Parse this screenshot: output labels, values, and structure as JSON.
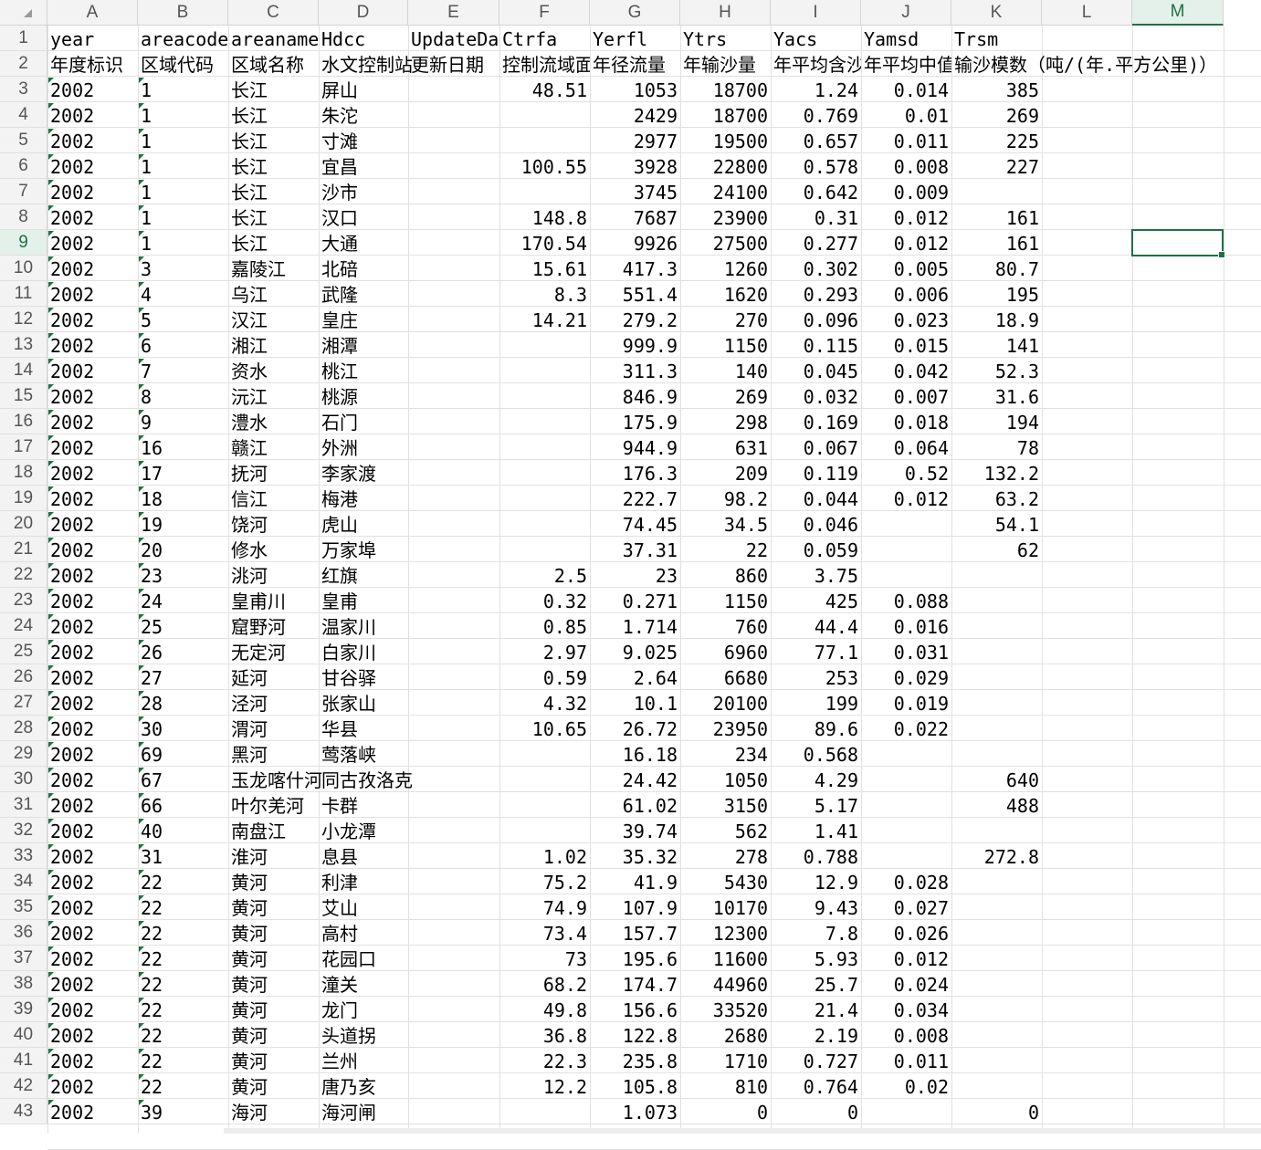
{
  "sheet": {
    "columns": [
      "A",
      "B",
      "C",
      "D",
      "E",
      "F",
      "G",
      "H",
      "I",
      "J",
      "K",
      "L",
      "M"
    ],
    "active_column": "M",
    "active_row": 9,
    "selected_cell": "M9",
    "rows": [
      {
        "n": "1",
        "A": "year",
        "B": "areacode",
        "C": "areaname",
        "D": "Hdcc",
        "E": "UpdateDate",
        "F": "Ctrfa",
        "G": "Yerfl",
        "H": "Ytrs",
        "I": "Yacs",
        "J": "Yamsd",
        "K": "Trsm",
        "L": "",
        "M": ""
      },
      {
        "n": "2",
        "A": "年度标识",
        "B": "区域代码",
        "C": "区域名称",
        "D": "水文控制站",
        "E": "更新日期",
        "F": "控制流域面积",
        "G": "年径流量",
        "H": "年输沙量",
        "I": "年平均含沙量",
        "J": "年平均中值粒径",
        "K": "输沙模数（吨/(年.平方公里)）",
        "L": "",
        "M": ""
      },
      {
        "n": "3",
        "A": "2002",
        "B": "1",
        "C": "长江",
        "D": "屏山",
        "E": "",
        "F": "48.51",
        "G": "1053",
        "H": "18700",
        "I": "1.24",
        "J": "0.014",
        "K": "385",
        "L": "",
        "M": ""
      },
      {
        "n": "4",
        "A": "2002",
        "B": "1",
        "C": "长江",
        "D": "朱沱",
        "E": "",
        "F": "",
        "G": "2429",
        "H": "18700",
        "I": "0.769",
        "J": "0.01",
        "K": "269",
        "L": "",
        "M": ""
      },
      {
        "n": "5",
        "A": "2002",
        "B": "1",
        "C": "长江",
        "D": "寸滩",
        "E": "",
        "F": "",
        "G": "2977",
        "H": "19500",
        "I": "0.657",
        "J": "0.011",
        "K": "225",
        "L": "",
        "M": ""
      },
      {
        "n": "6",
        "A": "2002",
        "B": "1",
        "C": "长江",
        "D": "宜昌",
        "E": "",
        "F": "100.55",
        "G": "3928",
        "H": "22800",
        "I": "0.578",
        "J": "0.008",
        "K": "227",
        "L": "",
        "M": ""
      },
      {
        "n": "7",
        "A": "2002",
        "B": "1",
        "C": "长江",
        "D": "沙市",
        "E": "",
        "F": "",
        "G": "3745",
        "H": "24100",
        "I": "0.642",
        "J": "0.009",
        "K": "",
        "L": "",
        "M": ""
      },
      {
        "n": "8",
        "A": "2002",
        "B": "1",
        "C": "长江",
        "D": "汉口",
        "E": "",
        "F": "148.8",
        "G": "7687",
        "H": "23900",
        "I": "0.31",
        "J": "0.012",
        "K": "161",
        "L": "",
        "M": ""
      },
      {
        "n": "9",
        "A": "2002",
        "B": "1",
        "C": "长江",
        "D": "大通",
        "E": "",
        "F": "170.54",
        "G": "9926",
        "H": "27500",
        "I": "0.277",
        "J": "0.012",
        "K": "161",
        "L": "",
        "M": ""
      },
      {
        "n": "10",
        "A": "2002",
        "B": "3",
        "C": "嘉陵江",
        "D": "北碚",
        "E": "",
        "F": "15.61",
        "G": "417.3",
        "H": "1260",
        "I": "0.302",
        "J": "0.005",
        "K": "80.7",
        "L": "",
        "M": ""
      },
      {
        "n": "11",
        "A": "2002",
        "B": "4",
        "C": "乌江",
        "D": "武隆",
        "E": "",
        "F": "8.3",
        "G": "551.4",
        "H": "1620",
        "I": "0.293",
        "J": "0.006",
        "K": "195",
        "L": "",
        "M": ""
      },
      {
        "n": "12",
        "A": "2002",
        "B": "5",
        "C": "汉江",
        "D": "皇庄",
        "E": "",
        "F": "14.21",
        "G": "279.2",
        "H": "270",
        "I": "0.096",
        "J": "0.023",
        "K": "18.9",
        "L": "",
        "M": ""
      },
      {
        "n": "13",
        "A": "2002",
        "B": "6",
        "C": "湘江",
        "D": "湘潭",
        "E": "",
        "F": "",
        "G": "999.9",
        "H": "1150",
        "I": "0.115",
        "J": "0.015",
        "K": "141",
        "L": "",
        "M": ""
      },
      {
        "n": "14",
        "A": "2002",
        "B": "7",
        "C": "资水",
        "D": "桃江",
        "E": "",
        "F": "",
        "G": "311.3",
        "H": "140",
        "I": "0.045",
        "J": "0.042",
        "K": "52.3",
        "L": "",
        "M": ""
      },
      {
        "n": "15",
        "A": "2002",
        "B": "8",
        "C": "沅江",
        "D": "桃源",
        "E": "",
        "F": "",
        "G": "846.9",
        "H": "269",
        "I": "0.032",
        "J": "0.007",
        "K": "31.6",
        "L": "",
        "M": ""
      },
      {
        "n": "16",
        "A": "2002",
        "B": "9",
        "C": "澧水",
        "D": "石门",
        "E": "",
        "F": "",
        "G": "175.9",
        "H": "298",
        "I": "0.169",
        "J": "0.018",
        "K": "194",
        "L": "",
        "M": ""
      },
      {
        "n": "17",
        "A": "2002",
        "B": "16",
        "C": "赣江",
        "D": "外洲",
        "E": "",
        "F": "",
        "G": "944.9",
        "H": "631",
        "I": "0.067",
        "J": "0.064",
        "K": "78",
        "L": "",
        "M": ""
      },
      {
        "n": "18",
        "A": "2002",
        "B": "17",
        "C": "抚河",
        "D": "李家渡",
        "E": "",
        "F": "",
        "G": "176.3",
        "H": "209",
        "I": "0.119",
        "J": "0.52",
        "K": "132.2",
        "L": "",
        "M": ""
      },
      {
        "n": "19",
        "A": "2002",
        "B": "18",
        "C": "信江",
        "D": "梅港",
        "E": "",
        "F": "",
        "G": "222.7",
        "H": "98.2",
        "I": "0.044",
        "J": "0.012",
        "K": "63.2",
        "L": "",
        "M": ""
      },
      {
        "n": "20",
        "A": "2002",
        "B": "19",
        "C": "饶河",
        "D": "虎山",
        "E": "",
        "F": "",
        "G": "74.45",
        "H": "34.5",
        "I": "0.046",
        "J": "",
        "K": "54.1",
        "L": "",
        "M": ""
      },
      {
        "n": "21",
        "A": "2002",
        "B": "20",
        "C": "修水",
        "D": "万家埠",
        "E": "",
        "F": "",
        "G": "37.31",
        "H": "22",
        "I": "0.059",
        "J": "",
        "K": "62",
        "L": "",
        "M": ""
      },
      {
        "n": "22",
        "A": "2002",
        "B": "23",
        "C": "洮河",
        "D": "红旗",
        "E": "",
        "F": "2.5",
        "G": "23",
        "H": "860",
        "I": "3.75",
        "J": "",
        "K": "",
        "L": "",
        "M": ""
      },
      {
        "n": "23",
        "A": "2002",
        "B": "24",
        "C": "皇甫川",
        "D": "皇甫",
        "E": "",
        "F": "0.32",
        "G": "0.271",
        "H": "1150",
        "I": "425",
        "J": "0.088",
        "K": "",
        "L": "",
        "M": ""
      },
      {
        "n": "24",
        "A": "2002",
        "B": "25",
        "C": "窟野河",
        "D": "温家川",
        "E": "",
        "F": "0.85",
        "G": "1.714",
        "H": "760",
        "I": "44.4",
        "J": "0.016",
        "K": "",
        "L": "",
        "M": ""
      },
      {
        "n": "25",
        "A": "2002",
        "B": "26",
        "C": "无定河",
        "D": "白家川",
        "E": "",
        "F": "2.97",
        "G": "9.025",
        "H": "6960",
        "I": "77.1",
        "J": "0.031",
        "K": "",
        "L": "",
        "M": ""
      },
      {
        "n": "26",
        "A": "2002",
        "B": "27",
        "C": "延河",
        "D": "甘谷驿",
        "E": "",
        "F": "0.59",
        "G": "2.64",
        "H": "6680",
        "I": "253",
        "J": "0.029",
        "K": "",
        "L": "",
        "M": ""
      },
      {
        "n": "27",
        "A": "2002",
        "B": "28",
        "C": "泾河",
        "D": "张家山",
        "E": "",
        "F": "4.32",
        "G": "10.1",
        "H": "20100",
        "I": "199",
        "J": "0.019",
        "K": "",
        "L": "",
        "M": ""
      },
      {
        "n": "28",
        "A": "2002",
        "B": "30",
        "C": "渭河",
        "D": "华县",
        "E": "",
        "F": "10.65",
        "G": "26.72",
        "H": "23950",
        "I": "89.6",
        "J": "0.022",
        "K": "",
        "L": "",
        "M": ""
      },
      {
        "n": "29",
        "A": "2002",
        "B": "69",
        "C": "黑河",
        "D": "莺落峡",
        "E": "",
        "F": "",
        "G": "16.18",
        "H": "234",
        "I": "0.568",
        "J": "",
        "K": "",
        "L": "",
        "M": ""
      },
      {
        "n": "30",
        "A": "2002",
        "B": "67",
        "C": "玉龙喀什河",
        "D": "同古孜洛克",
        "E": "",
        "F": "",
        "G": "24.42",
        "H": "1050",
        "I": "4.29",
        "J": "",
        "K": "640",
        "L": "",
        "M": ""
      },
      {
        "n": "31",
        "A": "2002",
        "B": "66",
        "C": "叶尔羌河",
        "D": "卡群",
        "E": "",
        "F": "",
        "G": "61.02",
        "H": "3150",
        "I": "5.17",
        "J": "",
        "K": "488",
        "L": "",
        "M": ""
      },
      {
        "n": "32",
        "A": "2002",
        "B": "40",
        "C": "南盘江",
        "D": "小龙潭",
        "E": "",
        "F": "",
        "G": "39.74",
        "H": "562",
        "I": "1.41",
        "J": "",
        "K": "",
        "L": "",
        "M": ""
      },
      {
        "n": "33",
        "A": "2002",
        "B": "31",
        "C": "淮河",
        "D": "息县",
        "E": "",
        "F": "1.02",
        "G": "35.32",
        "H": "278",
        "I": "0.788",
        "J": "",
        "K": "272.8",
        "L": "",
        "M": ""
      },
      {
        "n": "34",
        "A": "2002",
        "B": "22",
        "C": "黄河",
        "D": "利津",
        "E": "",
        "F": "75.2",
        "G": "41.9",
        "H": "5430",
        "I": "12.9",
        "J": "0.028",
        "K": "",
        "L": "",
        "M": ""
      },
      {
        "n": "35",
        "A": "2002",
        "B": "22",
        "C": "黄河",
        "D": "艾山",
        "E": "",
        "F": "74.9",
        "G": "107.9",
        "H": "10170",
        "I": "9.43",
        "J": "0.027",
        "K": "",
        "L": "",
        "M": ""
      },
      {
        "n": "36",
        "A": "2002",
        "B": "22",
        "C": "黄河",
        "D": "高村",
        "E": "",
        "F": "73.4",
        "G": "157.7",
        "H": "12300",
        "I": "7.8",
        "J": "0.026",
        "K": "",
        "L": "",
        "M": ""
      },
      {
        "n": "37",
        "A": "2002",
        "B": "22",
        "C": "黄河",
        "D": "花园口",
        "E": "",
        "F": "73",
        "G": "195.6",
        "H": "11600",
        "I": "5.93",
        "J": "0.012",
        "K": "",
        "L": "",
        "M": ""
      },
      {
        "n": "38",
        "A": "2002",
        "B": "22",
        "C": "黄河",
        "D": "潼关",
        "E": "",
        "F": "68.2",
        "G": "174.7",
        "H": "44960",
        "I": "25.7",
        "J": "0.024",
        "K": "",
        "L": "",
        "M": ""
      },
      {
        "n": "39",
        "A": "2002",
        "B": "22",
        "C": "黄河",
        "D": "龙门",
        "E": "",
        "F": "49.8",
        "G": "156.6",
        "H": "33520",
        "I": "21.4",
        "J": "0.034",
        "K": "",
        "L": "",
        "M": ""
      },
      {
        "n": "40",
        "A": "2002",
        "B": "22",
        "C": "黄河",
        "D": "头道拐",
        "E": "",
        "F": "36.8",
        "G": "122.8",
        "H": "2680",
        "I": "2.19",
        "J": "0.008",
        "K": "",
        "L": "",
        "M": ""
      },
      {
        "n": "41",
        "A": "2002",
        "B": "22",
        "C": "黄河",
        "D": "兰州",
        "E": "",
        "F": "22.3",
        "G": "235.8",
        "H": "1710",
        "I": "0.727",
        "J": "0.011",
        "K": "",
        "L": "",
        "M": ""
      },
      {
        "n": "42",
        "A": "2002",
        "B": "22",
        "C": "黄河",
        "D": "唐乃亥",
        "E": "",
        "F": "12.2",
        "G": "105.8",
        "H": "810",
        "I": "0.764",
        "J": "0.02",
        "K": "",
        "L": "",
        "M": ""
      },
      {
        "n": "43",
        "A": "2002",
        "B": "39",
        "C": "海河",
        "D": "海河闸",
        "E": "",
        "F": "",
        "G": "1.073",
        "H": "0",
        "I": "0",
        "J": "",
        "K": "0",
        "L": "",
        "M": ""
      }
    ]
  },
  "colors": {
    "accent": "#1e7145",
    "grid": "#e1e1e1",
    "header_bg": "#f3f3f3"
  }
}
